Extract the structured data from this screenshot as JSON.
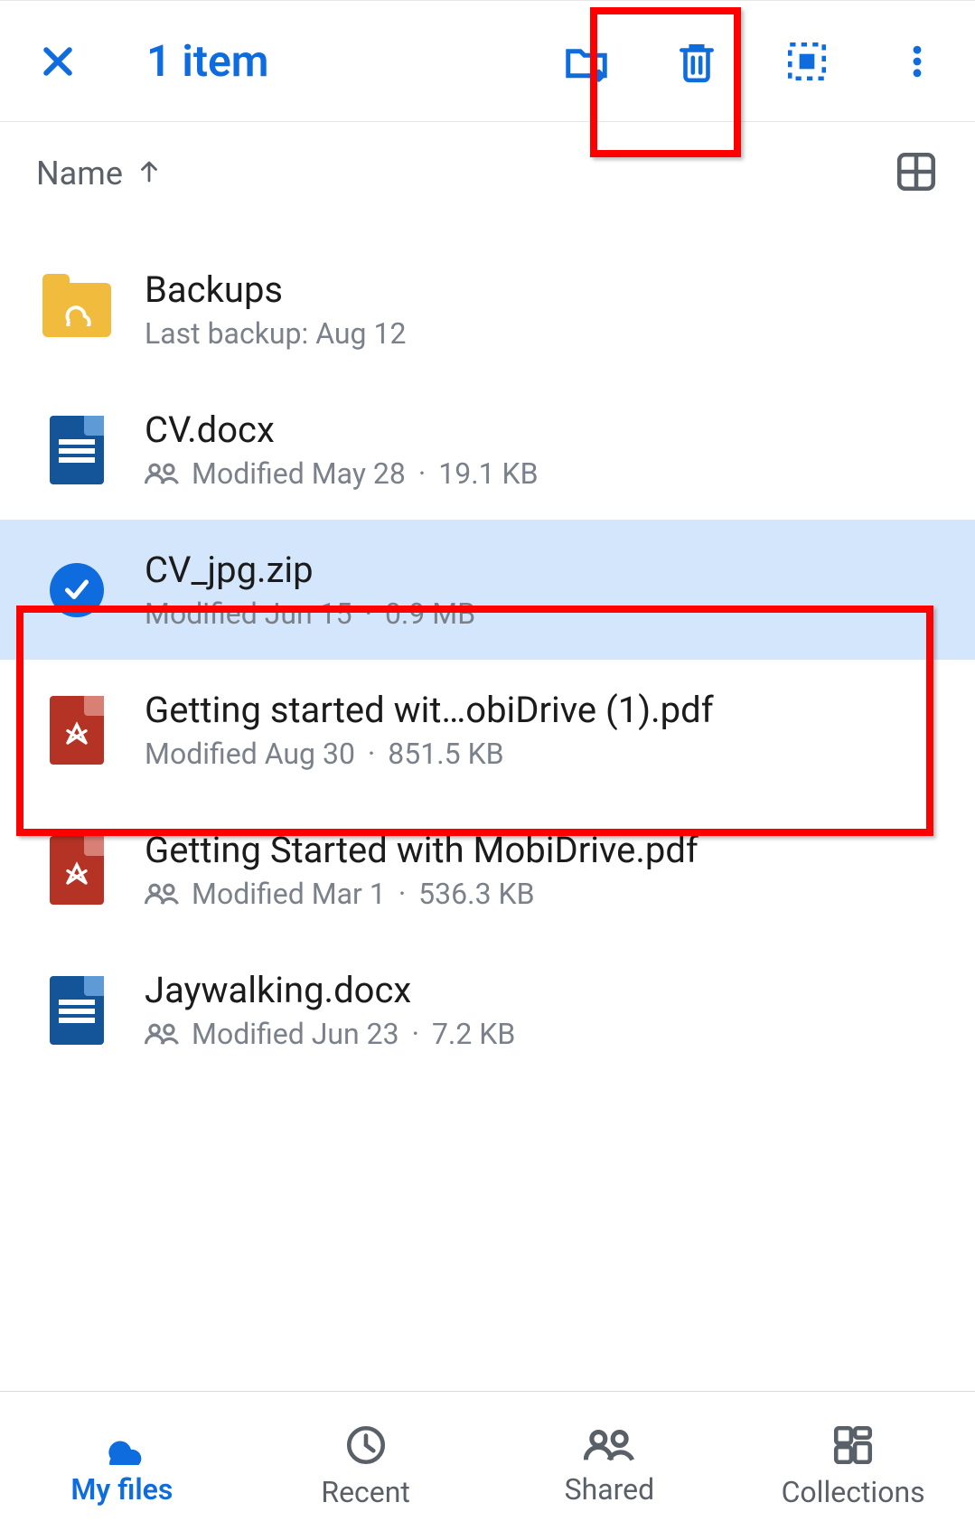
{
  "topbar": {
    "selection_label": "1 item"
  },
  "sort": {
    "label": "Name"
  },
  "rows": [
    {
      "name": "Backups",
      "meta1": "Last backup: Aug 12",
      "meta2": "",
      "shared": false,
      "type": "folder"
    },
    {
      "name": "CV.docx",
      "meta1": "Modified May 28",
      "meta2": "19.1 KB",
      "shared": true,
      "type": "docx"
    },
    {
      "name": "CV_jpg.zip",
      "meta1": "Modified Jun 15",
      "meta2": "0.9 MB",
      "shared": false,
      "type": "zip",
      "selected": true
    },
    {
      "name": "Getting started wit…obiDrive (1).pdf",
      "meta1": "Modified Aug 30",
      "meta2": "851.5 KB",
      "shared": false,
      "type": "pdf"
    },
    {
      "name": "Getting Started with MobiDrive.pdf",
      "meta1": "Modified Mar 1",
      "meta2": "536.3 KB",
      "shared": true,
      "type": "pdf"
    },
    {
      "name": "Jaywalking.docx",
      "meta1": "Modified Jun 23",
      "meta2": "7.2 KB",
      "shared": true,
      "type": "docx"
    }
  ],
  "nav": {
    "myfiles": "My files",
    "recent": "Recent",
    "shared": "Shared",
    "collections": "Collections"
  }
}
